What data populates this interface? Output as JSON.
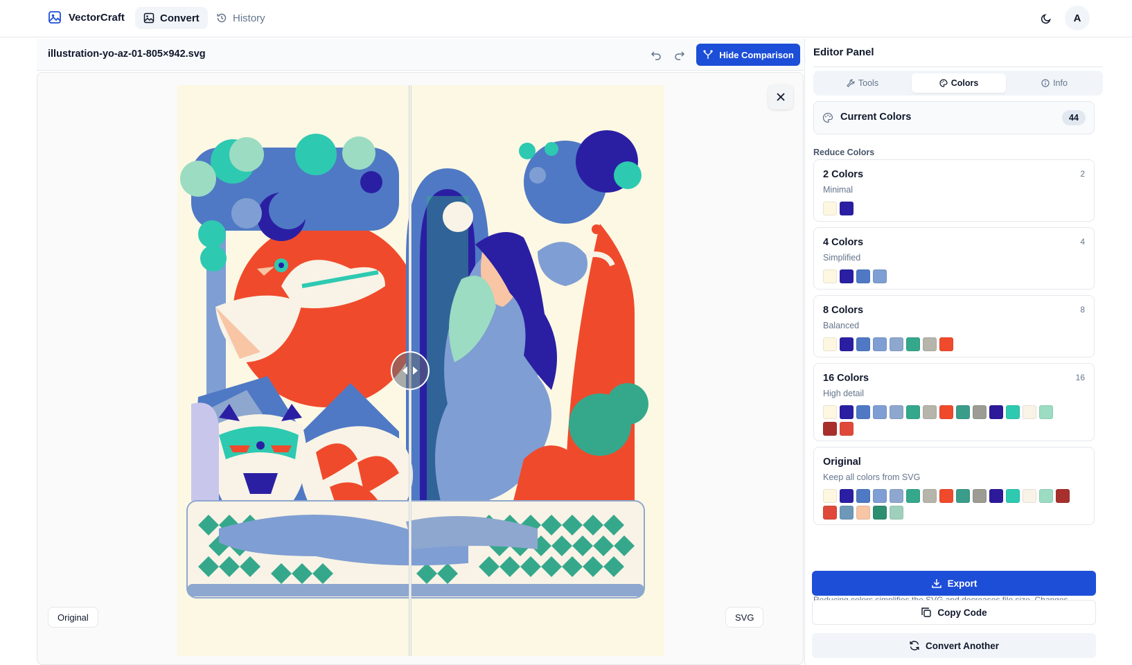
{
  "app": {
    "brand": "VectorCraft",
    "nav": [
      {
        "label": "Convert",
        "icon": "image-icon",
        "active": true
      },
      {
        "label": "History",
        "icon": "history-icon",
        "active": false
      }
    ],
    "avatar_initial": "A"
  },
  "file": {
    "name": "illustration-yo-az-01-805×942.svg",
    "hide_comparison_label": "Hide Comparison"
  },
  "canvas": {
    "left_tag": "Original",
    "right_tag": "SVG"
  },
  "panel": {
    "title": "Editor Panel",
    "tabs": [
      {
        "label": "Tools",
        "icon": "wrench-icon",
        "active": false
      },
      {
        "label": "Colors",
        "icon": "palette-icon",
        "active": true
      },
      {
        "label": "Info",
        "icon": "info-icon",
        "active": false
      }
    ],
    "current_colors_label": "Current Colors",
    "current_colors_count": "44",
    "reduce_label": "Reduce Colors",
    "options": [
      {
        "title": "2 Colors",
        "subtitle": "Minimal",
        "count": "2",
        "colors": [
          "#fdf7e1",
          "#2a1fa3"
        ]
      },
      {
        "title": "4 Colors",
        "subtitle": "Simplified",
        "count": "4",
        "colors": [
          "#fdf7e1",
          "#2a1fa3",
          "#4f79c4",
          "#7f9ed3"
        ]
      },
      {
        "title": "8 Colors",
        "subtitle": "Balanced",
        "count": "8",
        "colors": [
          "#fdf7e1",
          "#2a1fa3",
          "#4f79c4",
          "#7f9ed3",
          "#8ea7cf",
          "#35a88c",
          "#b5b5ab",
          "#f04a2c"
        ]
      },
      {
        "title": "16 Colors",
        "subtitle": "High detail",
        "count": "16",
        "colors": [
          "#fdf7e1",
          "#2a1fa3",
          "#4f79c4",
          "#7f9ed3",
          "#8ea7cf",
          "#35a88c",
          "#b5b5ab",
          "#f04a2c",
          "#3a9d8a",
          "#9c9c94",
          "#2c1a9a",
          "#2ec9b1",
          "#f8f3e6",
          "#9bdcc2",
          "#a8302c",
          "#e0493a"
        ]
      },
      {
        "title": "Original",
        "subtitle": "Keep all colors from SVG",
        "count": "",
        "colors": [
          "#fdf7e1",
          "#2a1fa3",
          "#4f79c4",
          "#7f9ed3",
          "#8ea7cf",
          "#35a88c",
          "#b5b5ab",
          "#f04a2c",
          "#3a9d8a",
          "#9c9c94",
          "#2c1a9a",
          "#2ec9b1",
          "#f8f3e6",
          "#9bdcc2",
          "#a8302c",
          "#e0493a",
          "#6e98b8",
          "#f8c5a5",
          "#2e8f70",
          "#9fd0bd"
        ]
      }
    ],
    "hint": "Reducing colors simplifies the SVG and decreases file size. Changes",
    "export_label": "Export",
    "copy_label": "Copy Code",
    "another_label": "Convert Another"
  },
  "colors": {
    "accent": "#1d4ed8",
    "cream": "#fdf8e3",
    "navy": "#2a1fa3",
    "periwinkle": "#7f9ed3",
    "mid_blue": "#4f79c4",
    "teal": "#2ec9b1",
    "mint": "#9bdcc2",
    "green": "#35a88c",
    "red_orange": "#f04a2c"
  }
}
